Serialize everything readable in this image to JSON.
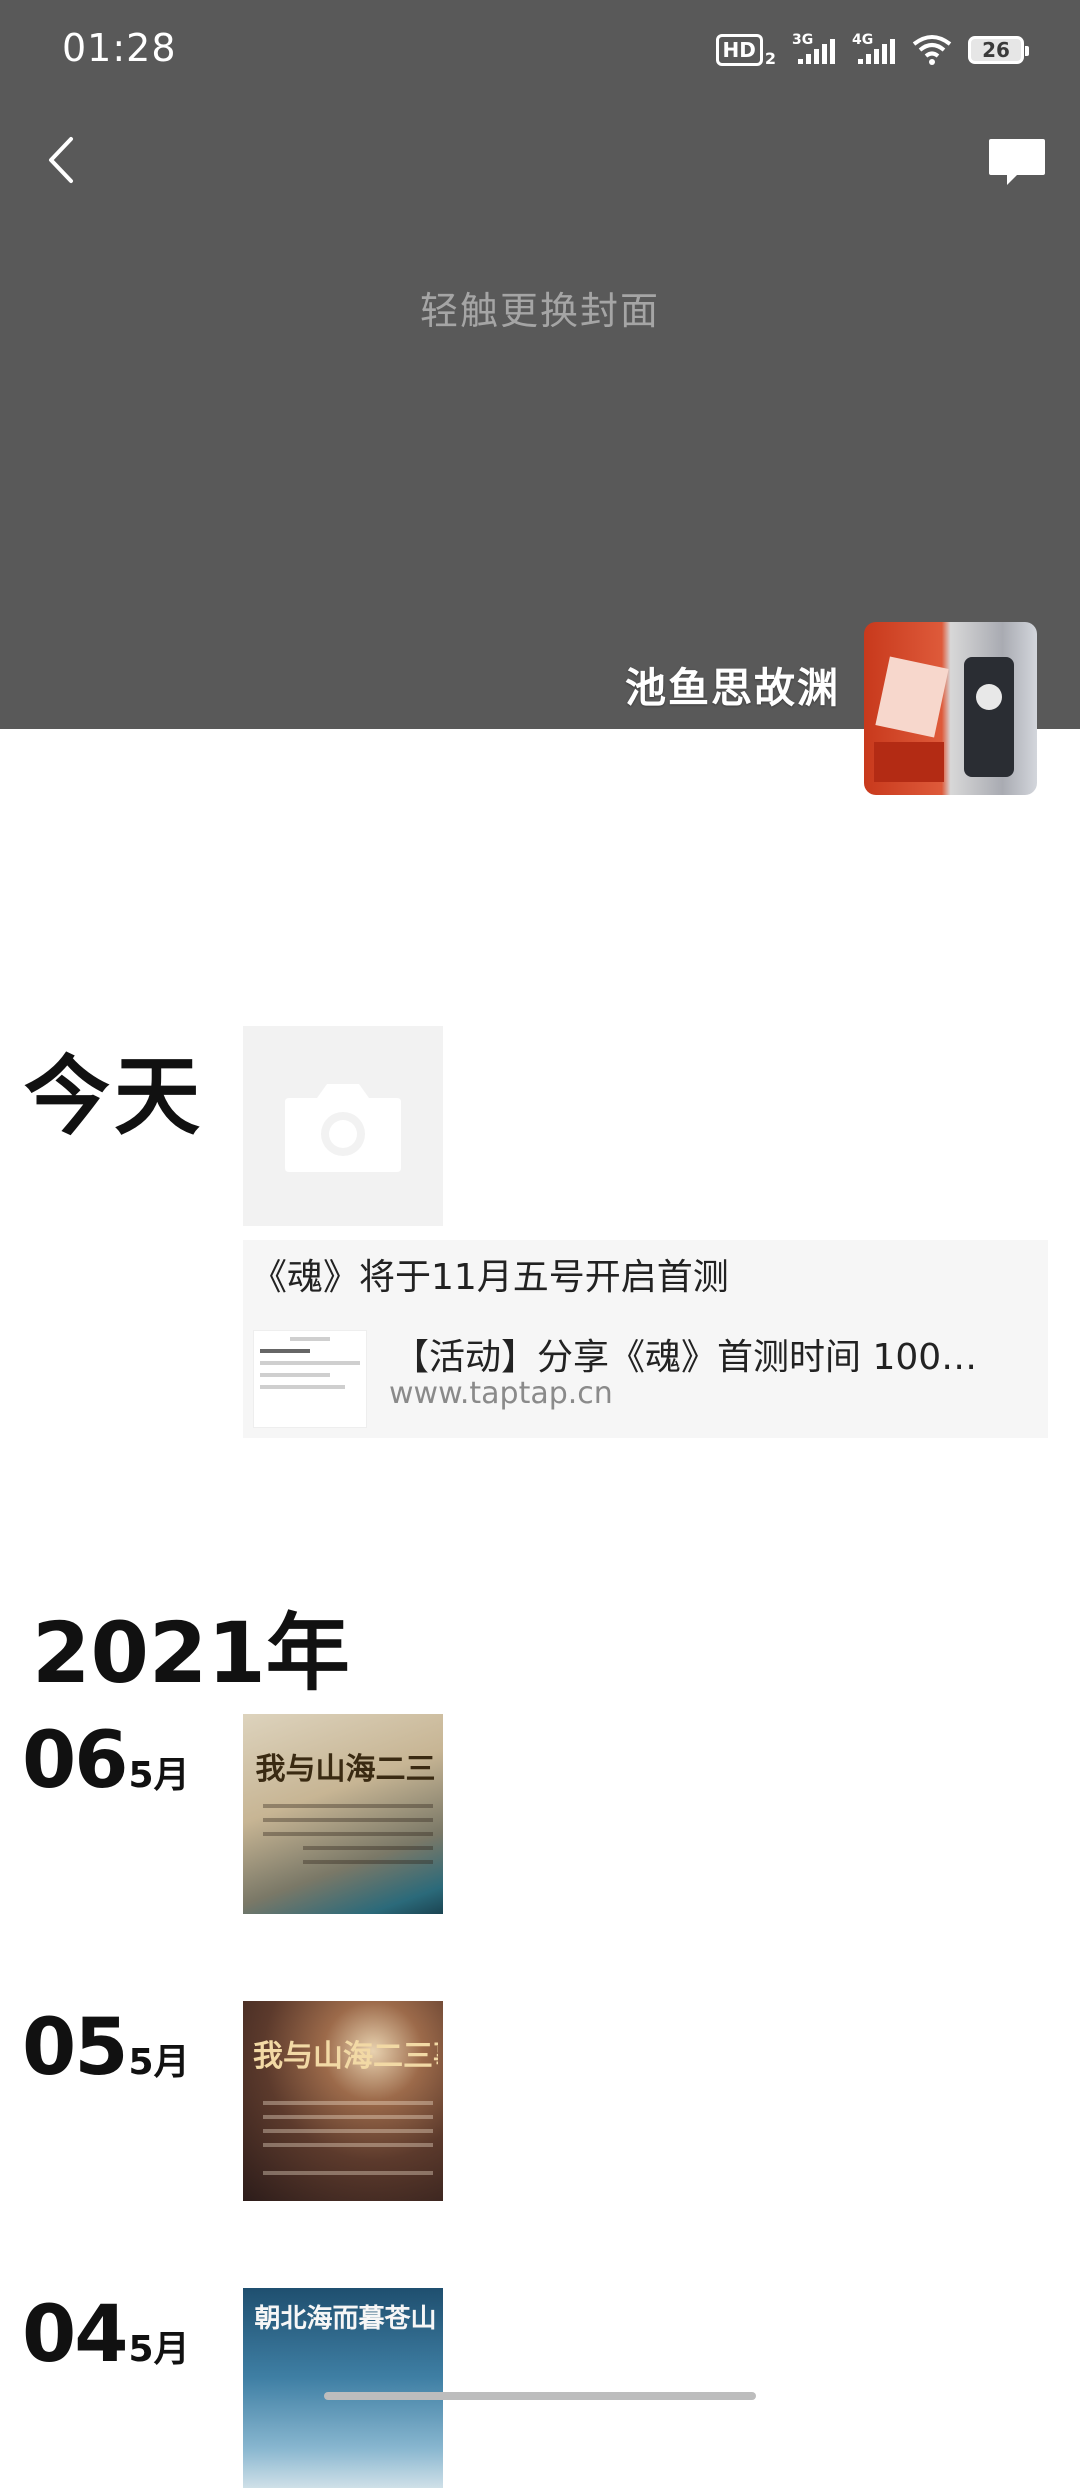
{
  "status_bar": {
    "time": "01:28",
    "hd": "HD",
    "hd_sub": "2",
    "signal1": "3G",
    "signal2": "4G",
    "battery": "26"
  },
  "header": {
    "back_icon": "chevron-left-icon",
    "message_icon": "message-icon",
    "cover_hint": "轻触更换封面",
    "username": "池鱼思故渊"
  },
  "timeline": {
    "today": {
      "label": "今天",
      "caption": "《魂》将于11月五号开启首测",
      "link_title": "【活动】分享《魂》首测时间 100…",
      "link_url": "www.taptap.cn"
    },
    "year": "2021年",
    "entries": [
      {
        "day": "06",
        "month": "5月",
        "poster_title": "我与山海二三"
      },
      {
        "day": "05",
        "month": "5月",
        "poster_title": "我与山海二三事"
      },
      {
        "day": "04",
        "month": "5月",
        "poster_title": "朝北海而暮苍山"
      }
    ]
  }
}
